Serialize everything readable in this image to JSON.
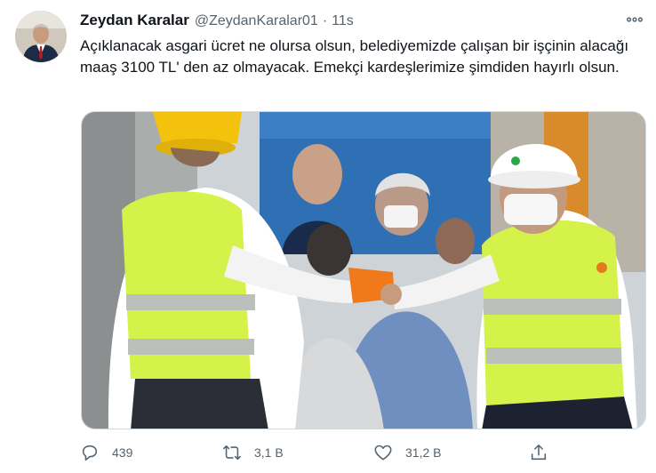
{
  "tweet": {
    "author_name": "Zeydan Karalar",
    "author_handle": "@ZeydanKaralar01",
    "separator": "·",
    "timestamp": "11s",
    "text": "Açıklanacak asgari ücret ne olursa olsun, belediyemizde çalışan bir işçinin alacağı maaş 3100 TL' den az olmayacak. Emekçi kardeşlerimize şimdiden hayırlı olsun."
  },
  "icons": {
    "more": "more-horizontal-icon",
    "reply": "reply-icon",
    "retweet": "retweet-icon",
    "like": "heart-icon",
    "share": "share-icon"
  },
  "actions": {
    "replies": "439",
    "retweets": "3,1 B",
    "likes": "31,2 B"
  },
  "colors": {
    "text": "#0f1419",
    "secondary": "#536471",
    "vest": "#d4f24a",
    "helmet_yellow": "#f4c20d"
  }
}
